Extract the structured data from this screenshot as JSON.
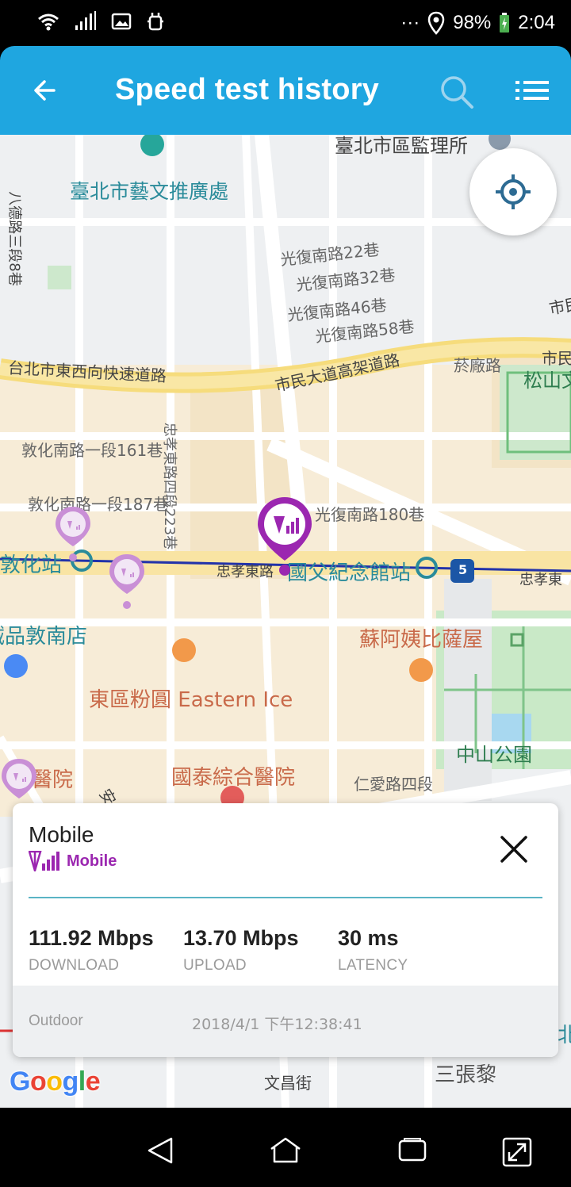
{
  "status_bar": {
    "battery": "98%",
    "time": "2:04",
    "more": "···",
    "icons": [
      "wifi-icon",
      "signal-icon",
      "image-icon",
      "debug-icon",
      "location-icon",
      "battery-icon"
    ]
  },
  "app_bar": {
    "title": "Speed test history",
    "icons": [
      "back-arrow-icon",
      "search-icon",
      "list-menu-icon"
    ],
    "color": "#1fa6e0"
  },
  "map": {
    "labels": {
      "tpe_district": "臺北市區監理所",
      "arts": "臺北市藝文推廣處",
      "bade": "八德路三段8巷",
      "gf22": "光復南路22巷",
      "gf32": "光復南路32巷",
      "gf46": "光復南路46巷",
      "gf58": "光復南路58巷",
      "expressway": "台北市東西向快速道路",
      "elevated": "市民大道高架道路",
      "caichang": "菸廠路",
      "songshan": "松山文",
      "shimin_r": "市民",
      "shi_r": "市民",
      "dunhua161": "敦化南路一段161巷",
      "dunhua187": "敦化南路一段187巷",
      "zhongxiao223": "忠孝東路四段223巷",
      "gf180": "光復南路180巷",
      "dunhua_station": "敦化站",
      "zhongxiao_road": "忠孝東路",
      "sun_yatsen_station": "國父紀念館站",
      "zhongxiao_right": "忠孝東",
      "route": "5",
      "dunnan": "誠品敦南店",
      "pizza": "蘇阿姨比薩屋",
      "eastern_ice": "東區粉圓 Eastern Ice",
      "zhongshan_park": "中山公園",
      "hospital_left": "醫院",
      "cathay_hospital": "國泰綜合醫院",
      "renai": "仁愛路四段",
      "an": "安",
      "wenchang": "文昌街",
      "sanzhangli": "三張黎",
      "north_r": "北"
    },
    "locate_button": "crosshair-icon",
    "pin_color_active": "#9b27b0",
    "pin_color_inactive": "#c98fd6"
  },
  "card": {
    "title": "Mobile",
    "network_type": "Mobile",
    "network_icon": "cell-tower-signal-icon",
    "download": {
      "value": "111.92 Mbps",
      "label": "DOWNLOAD"
    },
    "upload": {
      "value": "13.70 Mbps",
      "label": "UPLOAD"
    },
    "latency": {
      "value": "30 ms",
      "label": "LATENCY"
    },
    "environment": "Outdoor",
    "timestamp": "2018/4/1 下午12:38:41"
  },
  "attribution": {
    "letters": [
      "G",
      "o",
      "o",
      "g",
      "l",
      "e"
    ],
    "colors": [
      "#4285f4",
      "#ea4335",
      "#fbbc05",
      "#4285f4",
      "#34a853",
      "#ea4335"
    ]
  },
  "nav_bar": {
    "icons": [
      "nav-back-icon",
      "nav-home-icon",
      "nav-recents-icon",
      "nav-screenshot-icon"
    ]
  }
}
